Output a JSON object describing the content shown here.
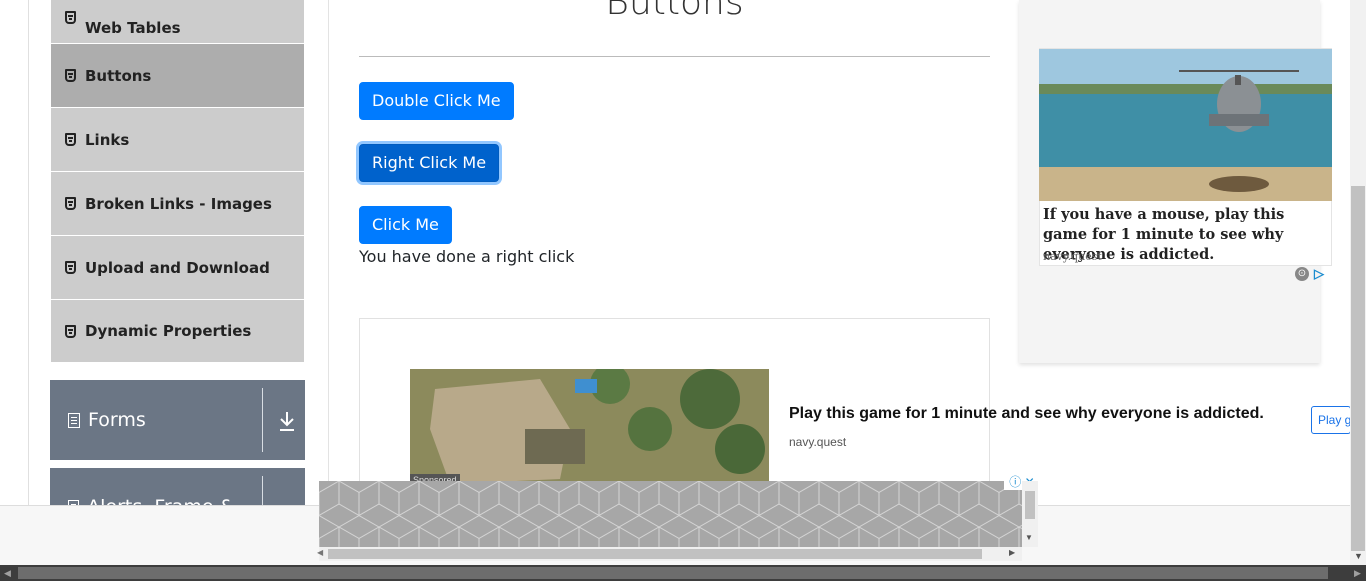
{
  "sidebar": {
    "items": [
      {
        "label": "Web Tables",
        "active": false
      },
      {
        "label": "Buttons",
        "active": true
      },
      {
        "label": "Links",
        "active": false
      },
      {
        "label": "Broken Links - Images",
        "active": false
      },
      {
        "label": "Upload and Download",
        "active": false
      },
      {
        "label": "Dynamic Properties",
        "active": false
      }
    ],
    "groups": [
      {
        "label": "Forms"
      },
      {
        "label": "Alerts, Frame & Windows"
      }
    ]
  },
  "main": {
    "title": "Buttons",
    "buttons": {
      "double_click": "Double Click Me",
      "right_click": "Right Click Me",
      "click": "Click Me"
    },
    "message": "You have done a right click"
  },
  "ad_right": {
    "headline": "If you have a mouse, play this game for 1 minute to see why everyone is addicted.",
    "source": "navy.quest"
  },
  "ad_middle": {
    "title": "Play this game for 1 minute and see why everyone is addicted.",
    "source": "navy.quest",
    "cta": "Play g",
    "sponsored": "Sponsored"
  },
  "colors": {
    "primary": "#007bff",
    "sidebar": "#cccccc",
    "sidebar_active": "#adadad",
    "group_header": "#6b7685"
  }
}
